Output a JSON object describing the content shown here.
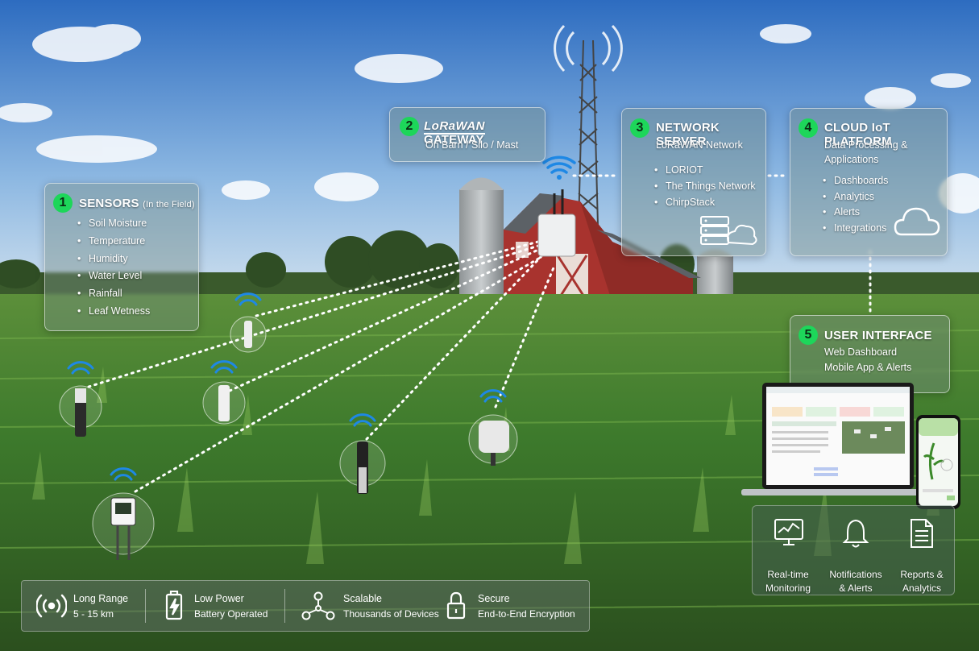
{
  "sensors": {
    "number": "1",
    "title": "SENSORS",
    "title_note": "(In the Field)",
    "items": [
      "Soil Moisture",
      "Temperature",
      "Humidity",
      "Water Level",
      "Rainfall",
      "Leaf Wetness"
    ]
  },
  "gateway": {
    "number": "2",
    "logo": "LoRaWAN",
    "title": "GATEWAY",
    "subtitle": "On Barn / Silo / Mast"
  },
  "network_server": {
    "number": "3",
    "title": "NETWORK SERVER",
    "subtitle": "LoRaWAN Network",
    "items": [
      "LORIOT",
      "The Things Network",
      "ChirpStack"
    ]
  },
  "cloud": {
    "number": "4",
    "title": "CLOUD IoT PLATFORM",
    "subtitle_line1": "Data Processing &",
    "subtitle_line2": "Applications",
    "items": [
      "Dashboards",
      "Analytics",
      "Alerts",
      "Integrations"
    ]
  },
  "user_interface": {
    "number": "5",
    "title": "USER INTERFACE",
    "line1": "Web Dashboard",
    "line2": "Mobile App & Alerts",
    "features": [
      {
        "line1": "Real-time",
        "line2": "Monitoring",
        "icon": "monitor-chart-icon"
      },
      {
        "line1": "Notifications",
        "line2": "& Alerts",
        "icon": "bell-icon"
      },
      {
        "line1": "Reports &",
        "line2": "Analytics",
        "icon": "report-document-icon"
      }
    ]
  },
  "benefits": [
    {
      "line1": "Long Range",
      "line2": "5 - 15 km",
      "icon": "radio-signal-icon"
    },
    {
      "line1": "Low Power",
      "line2": "Battery Operated",
      "icon": "battery-bolt-icon"
    },
    {
      "line1": "Scalable",
      "line2": "Thousands of Devices",
      "icon": "network-nodes-icon"
    },
    {
      "line1": "Secure",
      "line2": "End-to-End Encryption",
      "icon": "padlock-icon"
    }
  ],
  "colors": {
    "accent_green": "#1dd65a",
    "wifi_blue": "#1e88e5",
    "barn_red": "#a8332e",
    "sky_top": "#2f6fc0",
    "crop_green": "#3f7a2e"
  }
}
